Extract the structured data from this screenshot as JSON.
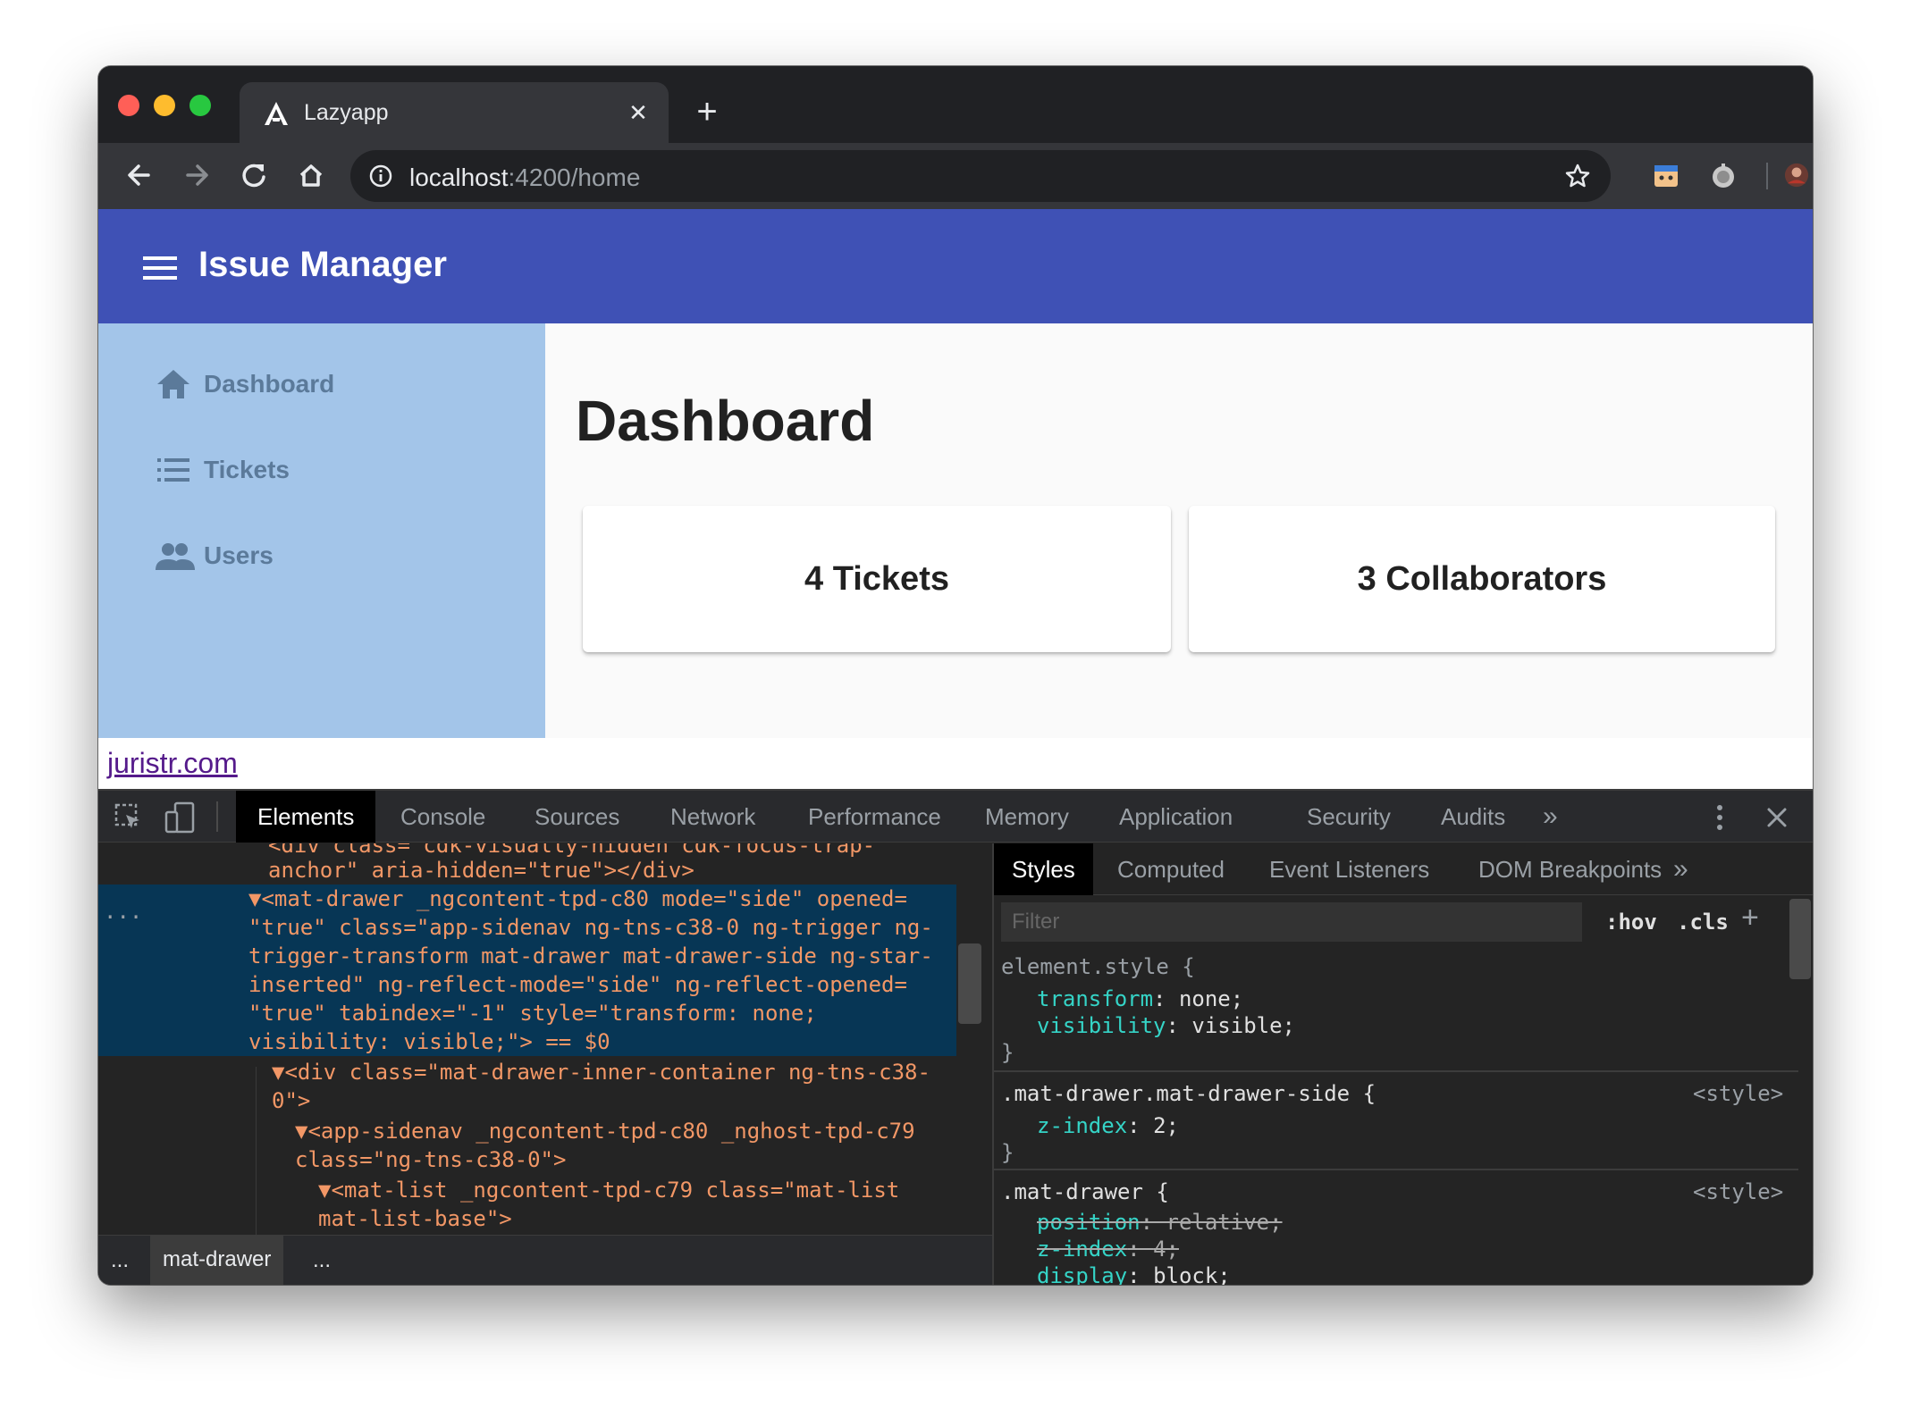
{
  "browser": {
    "tab_title": "Lazyapp",
    "url_host": "localhost",
    "url_path": ":4200/home",
    "new_tab_symbol": "+",
    "close_symbol": "✕",
    "icons": [
      "back-arrow-icon",
      "forward-arrow-icon",
      "reload-icon",
      "home-icon",
      "info-icon",
      "bookmark-star-icon",
      "extension-icon",
      "extension-icon",
      "profile-avatar-icon",
      "menu-dots-icon"
    ]
  },
  "app": {
    "title": "Issue Manager",
    "nav": [
      {
        "label": "Dashboard",
        "icon": "home-icon"
      },
      {
        "label": "Tickets",
        "icon": "list-icon"
      },
      {
        "label": "Users",
        "icon": "people-icon"
      }
    ],
    "page_title": "Dashboard",
    "cards": [
      "4 Tickets",
      "3 Collaborators"
    ],
    "footer_link": "juristr.com",
    "colors": {
      "primary": "#3f51b5",
      "sidenav": "#a3c5e9"
    }
  },
  "devtools": {
    "tabs": [
      "Elements",
      "Console",
      "Sources",
      "Network",
      "Performance",
      "Memory",
      "Application",
      "Security",
      "Audits"
    ],
    "more": "»",
    "breadcrumb": {
      "left_ellipsis": "...",
      "item": "mat-drawer",
      "right_ellipsis": "..."
    },
    "row_marker": "...",
    "elements": [
      {
        "t": "<div class=\"cdk-visually-hidden cdk-focus-trap-"
      },
      {
        "t": "anchor\" aria-hidden=\"true\"></div>"
      },
      {
        "t": "▼<mat-drawer _ngcontent-tpd-c80 mode=\"side\" opened="
      },
      {
        "t": "\"true\" class=\"app-sidenav ng-tns-c38-0 ng-trigger ng-"
      },
      {
        "t": "trigger-transform mat-drawer mat-drawer-side ng-star-"
      },
      {
        "t": "inserted\" ng-reflect-mode=\"side\" ng-reflect-opened="
      },
      {
        "t": "\"true\" tabindex=\"-1\" style=\"transform: none;"
      },
      {
        "t": "visibility: visible;\"> == $0"
      },
      {
        "t": "▼<div class=\"mat-drawer-inner-container ng-tns-c38-"
      },
      {
        "t": "0\">"
      },
      {
        "t": "▼<app-sidenav _ngcontent-tpd-c80 _nghost-tpd-c79"
      },
      {
        "t": "class=\"ng-tns-c38-0\">"
      },
      {
        "t": "▼<mat-list _ngcontent-tpd-c79 class=\"mat-list"
      },
      {
        "t": "mat-list-base\">"
      }
    ],
    "styles_tabs": [
      "Styles",
      "Computed",
      "Event Listeners",
      "DOM Breakpoints"
    ],
    "filter_placeholder": "Filter",
    "hov": ":hov",
    "cls": ".cls",
    "add": "+",
    "rules": [
      {
        "selector": "element.style {",
        "source": "",
        "props": [
          [
            "transform",
            "none;"
          ],
          [
            "visibility",
            "visible;"
          ]
        ]
      },
      {
        "selector": ".mat-drawer.mat-drawer-side {",
        "source": "<style>",
        "props": [
          [
            "z-index",
            "2;"
          ]
        ]
      },
      {
        "selector": ".mat-drawer {",
        "source": "<style>",
        "props": [
          [
            "position",
            "relative;"
          ],
          [
            "z-index",
            "4;"
          ],
          [
            "display",
            "block;"
          ]
        ]
      }
    ],
    "close_brace": "}"
  }
}
